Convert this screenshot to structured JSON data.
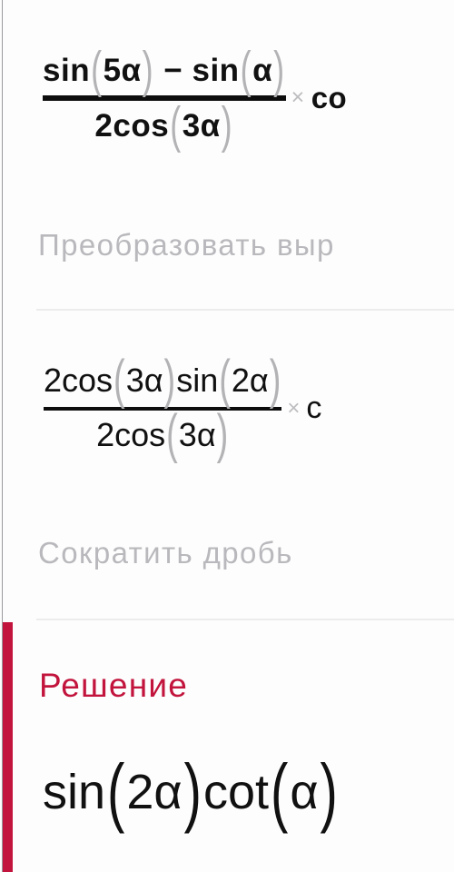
{
  "document": {
    "language": "ru",
    "background_color": "#fdfdfd",
    "accent_color": "#c2143c",
    "muted_text_color": "#b9b9bd",
    "paren_color": "#b3b3b6"
  },
  "steps": [
    {
      "id": "step-1",
      "expression": {
        "numerator": "sin (5α) − sin (α)",
        "denominator": "2cos (3α)",
        "numerator_parts": [
          "sin",
          "(",
          "5α",
          ")",
          "−",
          "sin",
          "(",
          "α",
          ")"
        ],
        "denominator_parts": [
          "2cos",
          "(",
          "3α",
          ")"
        ],
        "operator": "×",
        "trailing_clipped": "co",
        "full_line_clipped": "sin(5α) − sin(α) / 2cos(3α) × co"
      },
      "label": "Преобразовать выр"
    },
    {
      "id": "step-2",
      "expression": {
        "numerator": "2cos (3α) sin (2α)",
        "denominator": "2cos (3α)",
        "numerator_parts": [
          "2cos",
          "(",
          "3α",
          ")",
          "sin",
          "(",
          "2α",
          ")"
        ],
        "denominator_parts": [
          "2cos",
          "(",
          "3α",
          ")"
        ],
        "operator": "×",
        "trailing_clipped": "c",
        "full_line_clipped": "2cos(3α)sin(2α) / 2cos(3α) × c"
      },
      "label": "Сократить дробь"
    }
  ],
  "solution": {
    "heading": "Решение",
    "answer": "sin (2α)cot (α)",
    "answer_parts": [
      "sin",
      "(",
      "2α",
      ")",
      "cot",
      "(",
      "α",
      ")"
    ],
    "answer_clipped": true
  }
}
